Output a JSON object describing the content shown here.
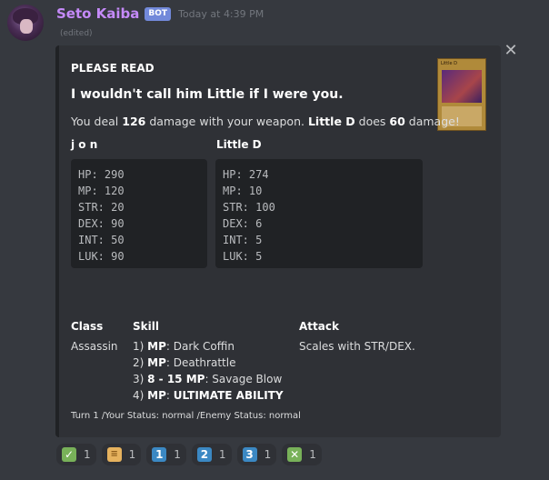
{
  "message": {
    "username": "Seto Kaiba",
    "bot_tag": "BOT",
    "timestamp": "Today at 4:39 PM",
    "edited": "(edited)"
  },
  "embed": {
    "author": "PLEASE READ",
    "title": "I wouldn't call him Little if I were you.",
    "desc": {
      "p1": "You deal ",
      "dmg1": "126",
      "p2": " damage with your weapon. ",
      "enemy": "Little D",
      "p3": " does ",
      "dmg2": "60",
      "p4": " damage!"
    },
    "thumbnail_card_name": "Little D",
    "player": {
      "name": "j o n",
      "stats": [
        "HP: 290",
        "MP: 120",
        "STR: 20",
        "DEX: 90",
        "INT: 50",
        "LUK: 90"
      ]
    },
    "enemy": {
      "name": "Little D",
      "stats": [
        "HP: 274",
        "MP: 10",
        "STR: 100",
        "DEX: 6",
        "INT: 5",
        "LUK: 5"
      ]
    },
    "class_field": {
      "name": "Class",
      "value": "Assassin"
    },
    "skill_field": {
      "name": "Skill",
      "lines": [
        {
          "prefix": "1) ",
          "bold": "MP",
          "rest": ": Dark Coffin"
        },
        {
          "prefix": "2) ",
          "bold": "MP",
          "rest": ": Deathrattle"
        },
        {
          "prefix": "3) ",
          "bold": "8 - 15 MP",
          "rest": ": Savage Blow"
        },
        {
          "prefix": "4) ",
          "bold": "MP",
          "rest": ": ",
          "bold2": "ULTIMATE ABILITY"
        }
      ]
    },
    "attack_field": {
      "name": "Attack",
      "value": "Scales with STR/DEX."
    },
    "footer": "Turn 1 /Your Status: normal /Enemy Status: normal"
  },
  "reactions": [
    {
      "icon": "check-mark-icon",
      "glyph": "✓",
      "count": "1"
    },
    {
      "icon": "scroll-icon",
      "glyph": "≡",
      "count": "1"
    },
    {
      "icon": "keycap-1-icon",
      "glyph": "1",
      "count": "1"
    },
    {
      "icon": "keycap-2-icon",
      "glyph": "2",
      "count": "1"
    },
    {
      "icon": "keycap-3-icon",
      "glyph": "3",
      "count": "1"
    },
    {
      "icon": "cross-mark-icon",
      "glyph": "✕",
      "count": "1"
    }
  ],
  "colors": {
    "background": "#36393f",
    "embed_bg": "#2f3136",
    "username": "#c58af9",
    "bot_tag": "#7289da"
  }
}
